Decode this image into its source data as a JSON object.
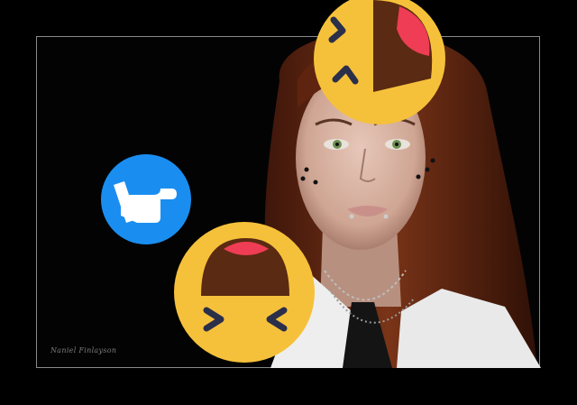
{
  "image": {
    "signature": "Naniel Finlayson",
    "colors": {
      "background": "#000000",
      "frame_border": "#8a8a8a",
      "emoji_yellow": "#f6c13a",
      "emoji_mouth": "#5a2a12",
      "emoji_tongue": "#ee3d54",
      "hand_blue": "#1a8ef0",
      "hair": "#6a2a14",
      "skin": "#d9b5a4"
    },
    "icons": [
      "laughing-face-icon",
      "laughing-face-icon",
      "pointing-hand-icon"
    ]
  }
}
